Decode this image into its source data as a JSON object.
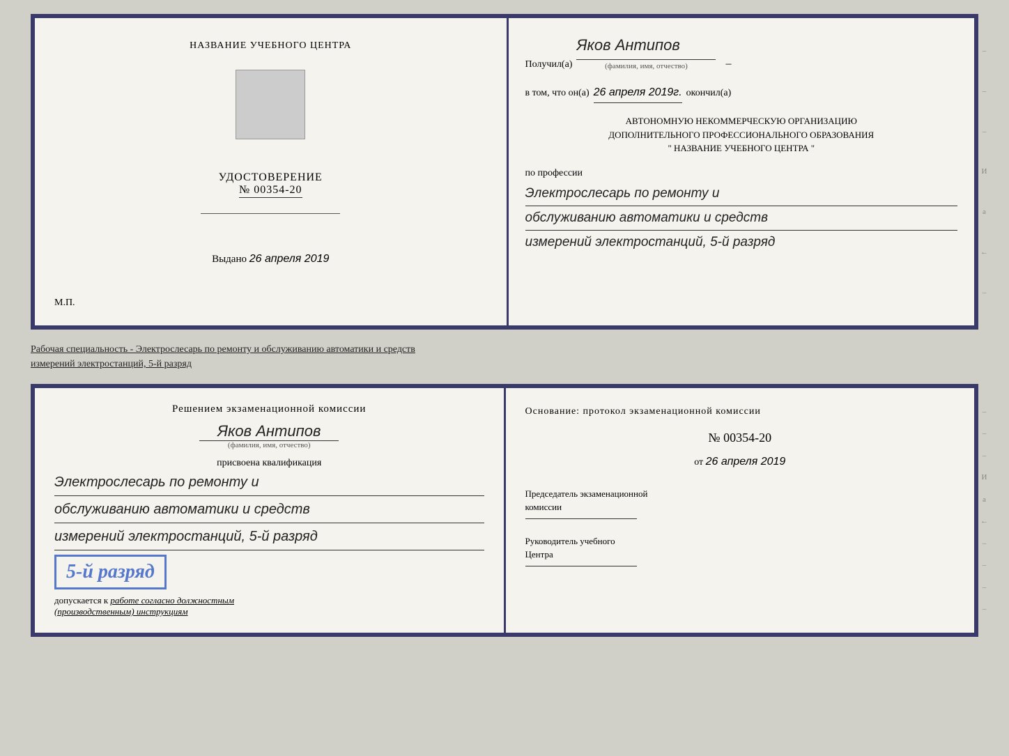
{
  "top_doc": {
    "left": {
      "center_name": "НАЗВАНИЕ УЧЕБНОГО ЦЕНТРА",
      "udostoverenie_label": "УДОСТОВЕРЕНИЕ",
      "number": "№ 00354-20",
      "vydano_label": "Выдано",
      "vydano_date": "26 апреля 2019",
      "mp_label": "М.П."
    },
    "right": {
      "poluchil_label": "Получил(а)",
      "name_handwritten": "Яков Антипов",
      "fio_sublabel": "(фамилия, имя, отчество)",
      "vtom_label": "в том, что он(а)",
      "date_handwritten": "26 апреля 2019г.",
      "okonchil_label": "окончил(а)",
      "org_line1": "АВТОНОМНУЮ НЕКОММЕРЧЕСКУЮ ОРГАНИЗАЦИЮ",
      "org_line2": "ДОПОЛНИТЕЛЬНОГО ПРОФЕССИОНАЛЬНОГО ОБРАЗОВАНИЯ",
      "org_name_quotes_open": "\"",
      "org_name": "НАЗВАНИЕ УЧЕБНОГО ЦЕНТРА",
      "org_name_quotes_close": "\"",
      "po_professii_label": "по профессии",
      "profession_line1": "Электрослесарь по ремонту и",
      "profession_line2": "обслуживанию автоматики и средств",
      "profession_line3": "измерений электростанций, 5-й разряд"
    }
  },
  "between": {
    "text": "Рабочая специальность - Электрослесарь по ремонту и обслуживанию автоматики и средств",
    "text2": "измерений электростанций, 5-й разряд"
  },
  "bottom_doc": {
    "left": {
      "resheniem_label": "Решением экзаменационной комиссии",
      "name_handwritten": "Яков Антипов",
      "fio_sublabel": "(фамилия, имя, отчество)",
      "prisvoena_label": "присвоена квалификация",
      "qual_line1": "Электрослесарь по ремонту и",
      "qual_line2": "обслуживанию автоматики и средств",
      "qual_line3": "измерений электростанций, 5-й разряд",
      "razryad_badge": "5-й разряд",
      "dopuskaetsya_label": "допускается к",
      "dopuskaetsya_text": "работе согласно должностным",
      "dopuskaetsya_text2": "(производственным) инструкциям"
    },
    "right": {
      "osnovanie_label": "Основание: протокол экзаменационной комиссии",
      "number_label": "№ 00354-20",
      "ot_label": "от",
      "ot_date": "26 апреля 2019",
      "predsedatel_line1": "Председатель экзаменационной",
      "predsedatel_line2": "комиссии",
      "rukovoditel_line1": "Руководитель учебного",
      "rukovoditel_line2": "Центра"
    }
  },
  "edge_marks": {
    "items": [
      "И",
      "а",
      "←",
      "–",
      "–",
      "–",
      "–"
    ]
  }
}
